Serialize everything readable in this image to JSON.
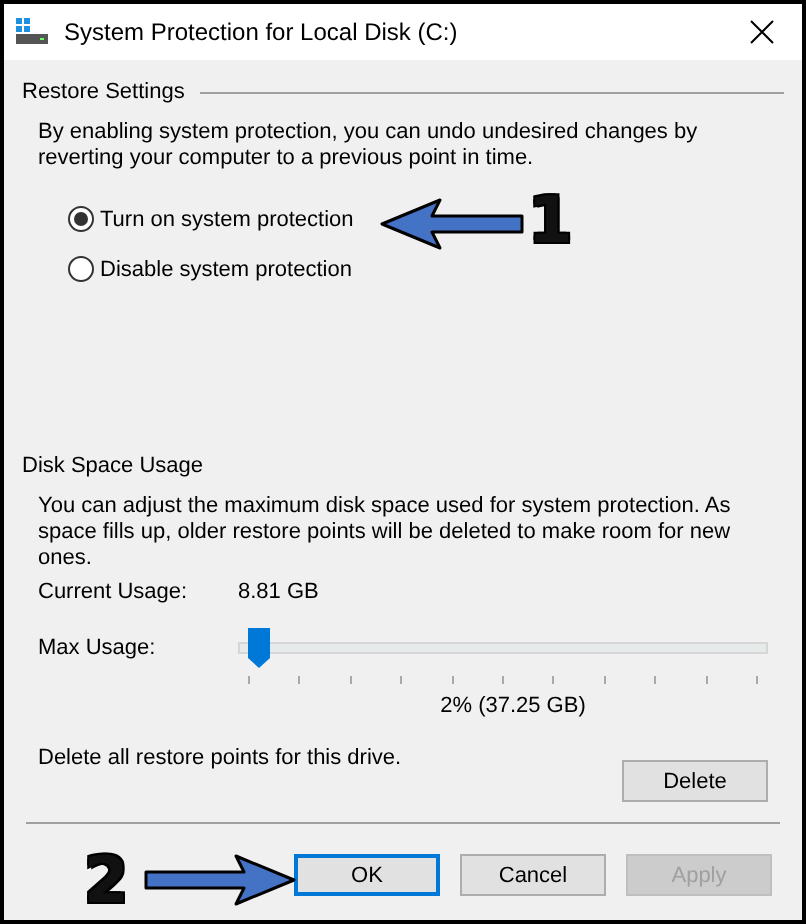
{
  "window": {
    "title": "System Protection for Local Disk (C:)"
  },
  "restore_settings": {
    "title": "Restore Settings",
    "description": "By enabling system protection, you can undo undesired changes by reverting your computer to a previous point in time.",
    "options": [
      {
        "label": "Turn on system protection",
        "selected": true
      },
      {
        "label": "Disable system protection",
        "selected": false
      }
    ]
  },
  "disk_space_usage": {
    "title": "Disk Space Usage",
    "description": "You can adjust the maximum disk space used for system protection. As space fills up, older restore points will be deleted to make room for new ones.",
    "current_usage": {
      "label": "Current Usage:",
      "value": "8.81 GB"
    },
    "max_usage": {
      "label": "Max Usage:",
      "level": 0.02,
      "reading": "2% (37.25 GB)"
    },
    "delete_text": "Delete all restore points for this drive.",
    "delete_button": "Delete"
  },
  "buttons": [
    {
      "label": "OK",
      "default": true,
      "disabled": false
    },
    {
      "label": "Cancel",
      "default": false,
      "disabled": false
    },
    {
      "label": "Apply",
      "default": false,
      "disabled": true
    }
  ],
  "annotations": [
    {
      "label": "1"
    },
    {
      "label": "2"
    }
  ]
}
